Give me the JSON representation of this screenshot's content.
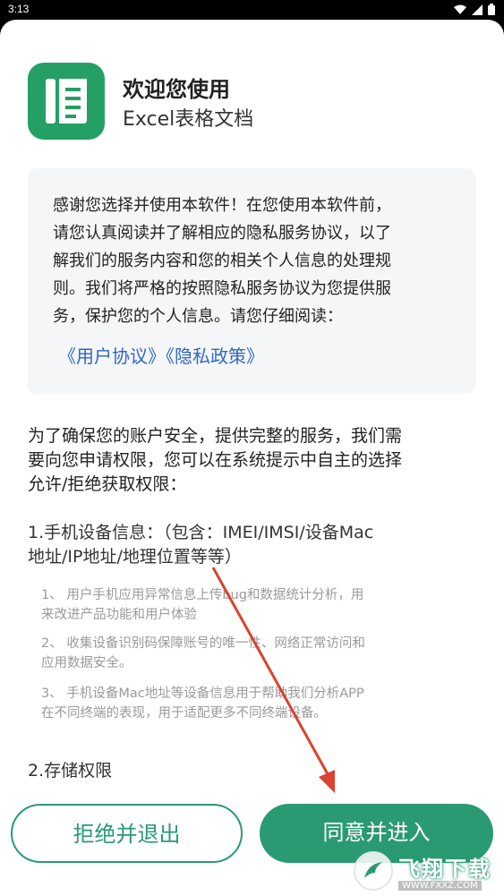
{
  "status_bar": {
    "time": "3:13",
    "icons": [
      "wifi-icon",
      "cellular-icon",
      "battery-icon"
    ]
  },
  "app": {
    "title": "欢迎您使用",
    "name": "Excel表格文档",
    "icon_color": "#24a065"
  },
  "intro": {
    "text": "感谢您选择并使用本软件！在您使用本软件前，\n请您认真阅读并了解相应的隐私服务协议，以了\n解我们的服务内容和您的相关个人信息的处理规\n则。我们将严格的按照隐私服务协议为您提供服\n务，保护您的个人信息。请您仔细阅读：",
    "user_agreement_link": "《用户协议》",
    "privacy_policy_link": "《隐私政策》"
  },
  "permissions": {
    "intro": "为了确保您的账户安全，提供完整的服务，我们需\n要向您申请权限，您可以在系统提示中自主的选择\n允许/拒绝获取权限：",
    "device_info": {
      "title": "1.手机设备信息：（包含：IMEI/IMSI/设备Mac\n地址/IP地址/地理位置等等）",
      "items": [
        "1、 用户手机应用异常信息上传bug和数据统计分析，用\n来改进产品功能和用户体验",
        "2、 收集设备识别码保障账号的唯一性、网络正常访问和\n应用数据安全。",
        "3、 手机设备Mac地址等设备信息用于帮助我们分析APP\n在不同终端的表现，用于适配更多不同终端设备。"
      ]
    },
    "storage": {
      "title": "2.存储权限"
    }
  },
  "buttons": {
    "reject": "拒绝并退出",
    "agree": "同意并进入"
  },
  "watermark": {
    "text": "飞翔下载",
    "url": "WWW.FXXZ.COM"
  },
  "colors": {
    "accent": "#2a9a72",
    "link": "#2d67c4",
    "annotation_arrow": "#d9432f"
  }
}
